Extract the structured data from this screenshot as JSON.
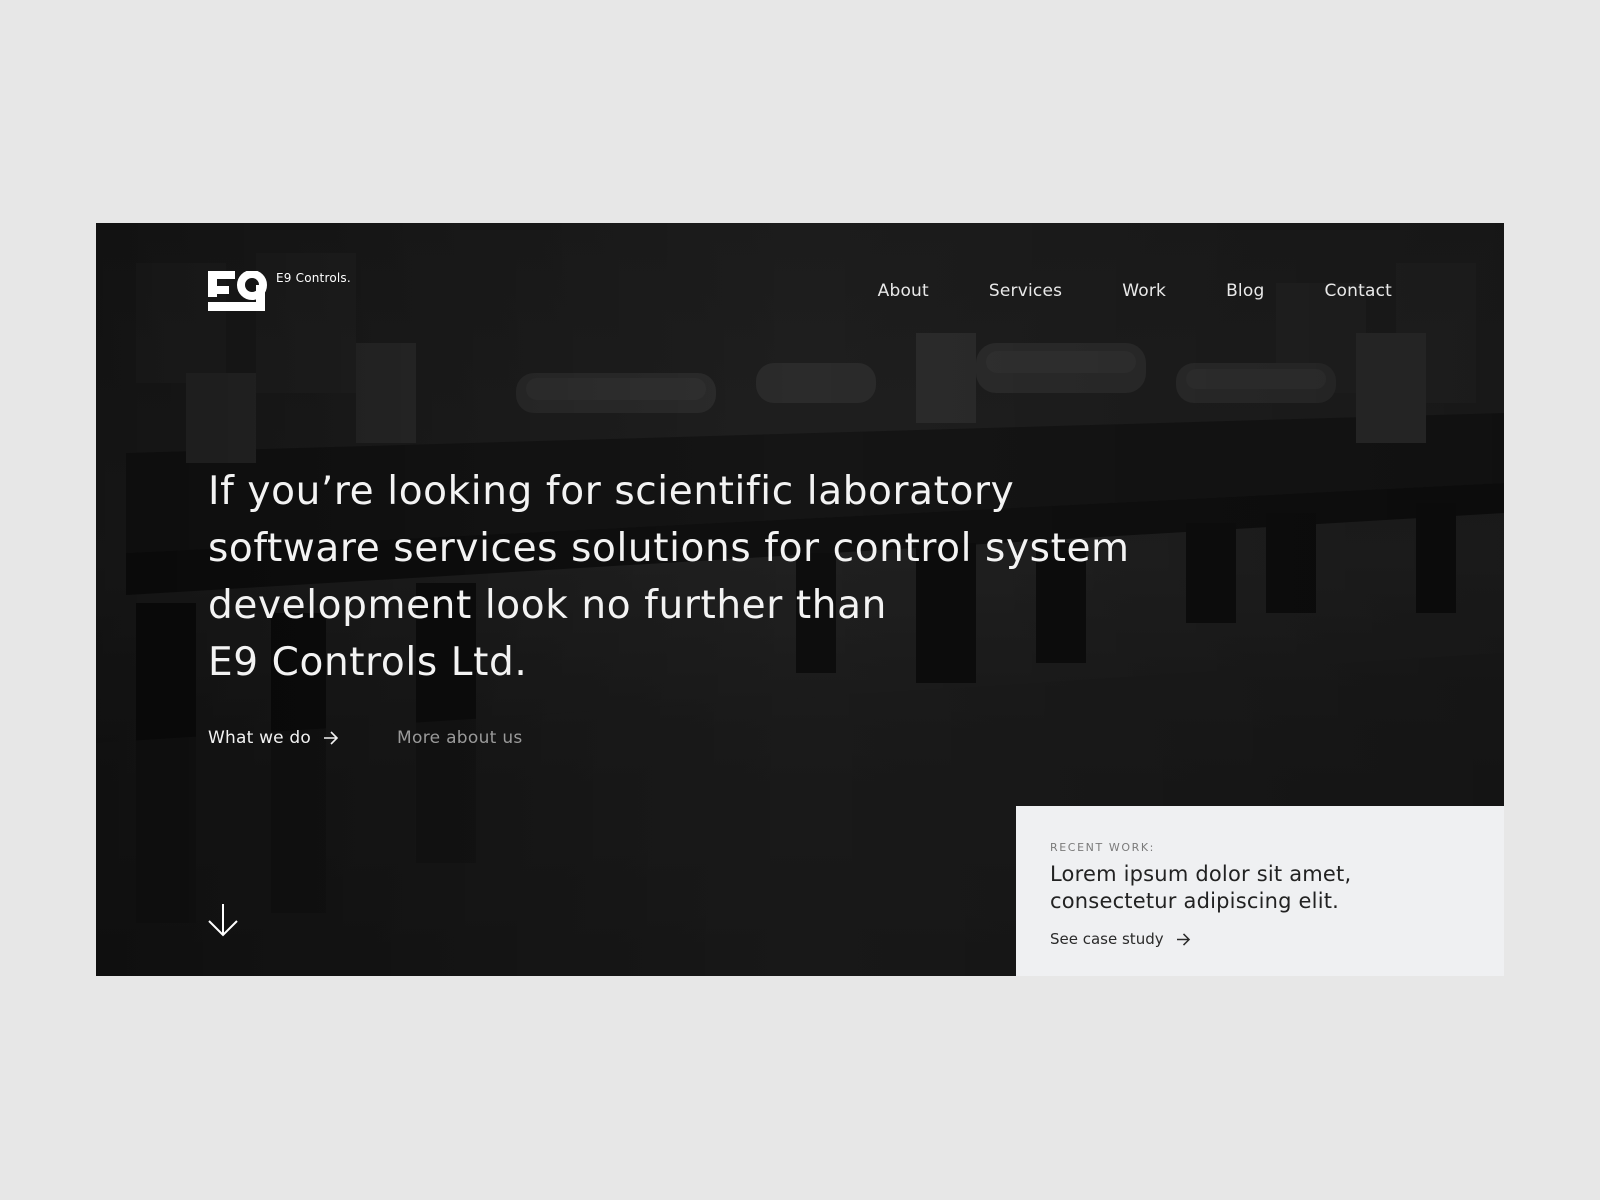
{
  "brand": {
    "name": "E9 Controls.",
    "logo_icon": "e9-logo-icon"
  },
  "nav": {
    "items": [
      {
        "label": "About"
      },
      {
        "label": "Services"
      },
      {
        "label": "Work"
      },
      {
        "label": "Blog"
      },
      {
        "label": "Contact"
      }
    ]
  },
  "hero": {
    "headline_lines": [
      "If you’re looking for scientific laboratory",
      "software services solutions for control system",
      "development look no further than",
      "E9 Controls Ltd."
    ],
    "primary_cta": "What we do",
    "secondary_cta": "More about us"
  },
  "recent_work": {
    "label": "RECENT WORK:",
    "title": "Lorem ipsum dolor sit amet, consectetur adipiscing elit.",
    "link": "See case study"
  },
  "colors": {
    "page_bg": "#e7e7e7",
    "hero_bg": "#1f1f1f",
    "card_bg": "#eff0f2",
    "text_light": "#f3f3f3",
    "text_muted": "#9a9a9a"
  }
}
